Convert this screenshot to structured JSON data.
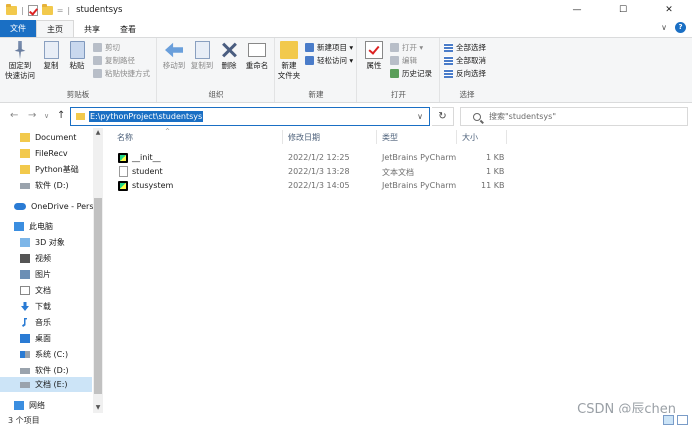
{
  "window": {
    "title": "studentsys",
    "qat_separator": "|",
    "qat_dropdown": "=",
    "controls": {
      "minimize": "—",
      "maximize": "☐",
      "close": "✕"
    }
  },
  "tabs": [
    {
      "label": "文件"
    },
    {
      "label": "主页"
    },
    {
      "label": "共享"
    },
    {
      "label": "查看"
    }
  ],
  "ribbon_right": {
    "chevron": "∨",
    "help": "?"
  },
  "ribbon": {
    "clipboard": {
      "label": "剪贴板",
      "pin": "固定到\n快速访问",
      "copy": "复制",
      "paste": "粘贴",
      "cut": "剪切",
      "copy_path": "复制路径",
      "paste_shortcut": "粘贴快捷方式"
    },
    "organize": {
      "label": "组织",
      "move_to": "移动到",
      "copy_to": "复制到",
      "delete": "删除",
      "rename": "重命名"
    },
    "new": {
      "label": "新建",
      "new_folder": "新建\n文件夹",
      "new_item": "新建项目 ▾",
      "easy_access": "轻松访问 ▾"
    },
    "open": {
      "label": "打开",
      "properties": "属性",
      "open": "打开 ▾",
      "edit": "编辑",
      "history": "历史记录"
    },
    "select": {
      "label": "选择",
      "select_all": "全部选择",
      "select_none": "全部取消",
      "invert": "反向选择"
    }
  },
  "address": {
    "back": "←",
    "forward": "→",
    "recent": "∨",
    "up": "↑",
    "path": "E:\\pythonProject\\studentsys",
    "dropdown": "∨",
    "refresh": "↻",
    "search_placeholder": "搜索\"studentsys\""
  },
  "sidebar": {
    "items": [
      {
        "label": "Document",
        "icon": "folder-icon"
      },
      {
        "label": "FileRecv",
        "icon": "folder-icon"
      },
      {
        "label": "Python基础",
        "icon": "folder-icon"
      },
      {
        "label": "软件 (D:)",
        "icon": "drive-icon"
      },
      {
        "label": "OneDrive - Perso",
        "icon": "cloud-icon"
      },
      {
        "label": "此电脑",
        "icon": "computer-icon"
      },
      {
        "label": "3D 对象",
        "icon": "cube-icon"
      },
      {
        "label": "视频",
        "icon": "video-icon"
      },
      {
        "label": "图片",
        "icon": "picture-icon"
      },
      {
        "label": "文档",
        "icon": "document-icon"
      },
      {
        "label": "下载",
        "icon": "download-icon"
      },
      {
        "label": "音乐",
        "icon": "music-icon"
      },
      {
        "label": "桌面",
        "icon": "desktop-icon"
      },
      {
        "label": "系统 (C:)",
        "icon": "windows-drive-icon"
      },
      {
        "label": "软件 (D:)",
        "icon": "drive-icon"
      },
      {
        "label": "文档 (E:)",
        "icon": "drive-icon"
      },
      {
        "label": "网络",
        "icon": "network-icon"
      }
    ],
    "scroll_up": "▲",
    "scroll_down": "▼"
  },
  "columns": {
    "name": "名称",
    "sort_indicator": "^",
    "modified": "修改日期",
    "type": "类型",
    "size": "大小"
  },
  "files": [
    {
      "name": "__init__",
      "modified": "2022/1/2 12:25",
      "type": "JetBrains PyCharm",
      "size": "1 KB",
      "icon": "pycharm-file-icon"
    },
    {
      "name": "student",
      "modified": "2022/1/3 13:28",
      "type": "文本文档",
      "size": "1 KB",
      "icon": "text-file-icon"
    },
    {
      "name": "stusystem",
      "modified": "2022/1/3 14:05",
      "type": "JetBrains PyCharm",
      "size": "11 KB",
      "icon": "pycharm-file-icon"
    }
  ],
  "status": {
    "item_count": "3 个项目"
  },
  "watermark": "CSDN @辰chen"
}
